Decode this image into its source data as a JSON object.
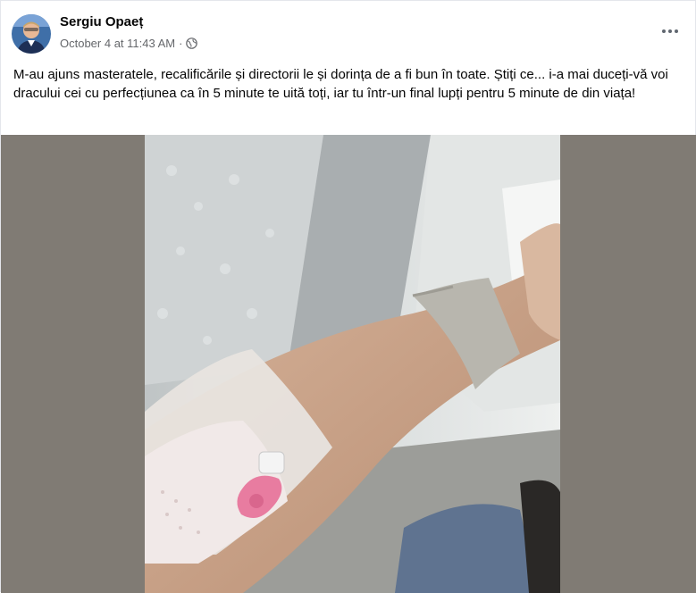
{
  "author": {
    "name": "Sergiu Opaeț"
  },
  "meta": {
    "timestamp": "October 4 at 11:43 AM",
    "separator": "·",
    "privacy_icon": "globe-icon"
  },
  "menu": {
    "icon": "more-dots-icon"
  },
  "post": {
    "text": "M-au ajuns masteratele, recalificările și directorii le și dorința de a fi bun în toate. Știți ce... i-a mai duceți-vă voi dracului cei cu perfecțiunea ca în 5 minute te uită toți, iar tu într-un final lupți pentru 5 minute de din viața!"
  },
  "photo": {
    "description_icon": "photo-image"
  },
  "colors": {
    "photo_background": "#807b74",
    "meta_text": "#65676b"
  }
}
